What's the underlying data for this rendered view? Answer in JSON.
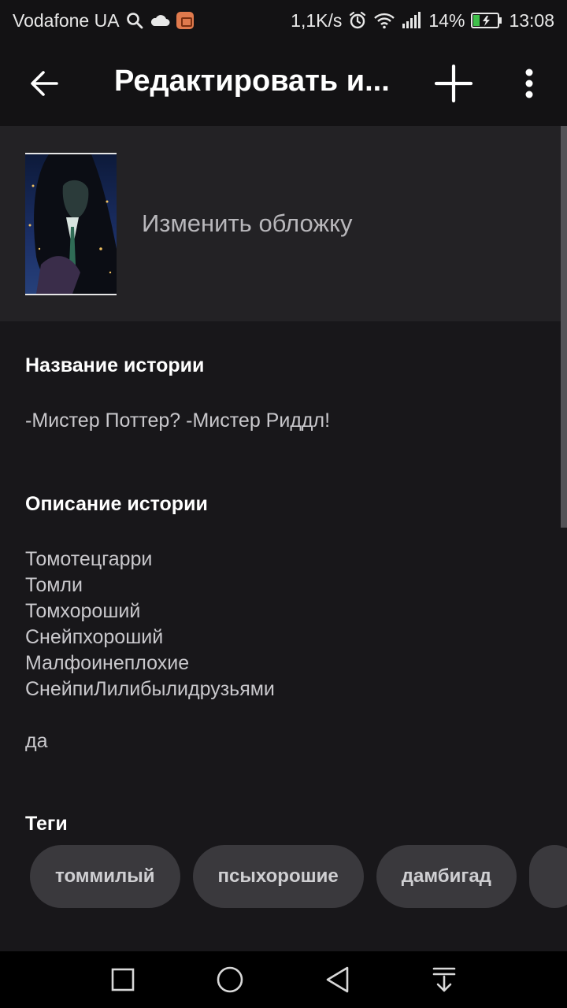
{
  "status_bar": {
    "carrier": "Vodafone UA",
    "speed": "1,1K/s",
    "battery_percent": "14%",
    "time": "13:08"
  },
  "app_bar": {
    "title": "Редактировать и..."
  },
  "cover": {
    "change_label": "Изменить обложку"
  },
  "story": {
    "title_label": "Название истории",
    "title_value": "-Мистер Поттер? -Мистер Риддл!",
    "description_label": "Описание истории",
    "description_lines": [
      "Томотецгарри",
      "Томли",
      "Томхороший",
      "Снейпхороший",
      "Малфоинеплохие",
      "СнейпиЛилибылидрузьями"
    ],
    "description_tail": "да",
    "tags_label": "Теги",
    "tags": [
      "томмилый",
      "псыхорошие",
      "дамбигад"
    ]
  },
  "colors": {
    "background": "#18171a",
    "bar": "#131214",
    "cover_panel": "#232225",
    "tag_bg": "#3a393d",
    "battery_fill": "#3fbf4a"
  }
}
